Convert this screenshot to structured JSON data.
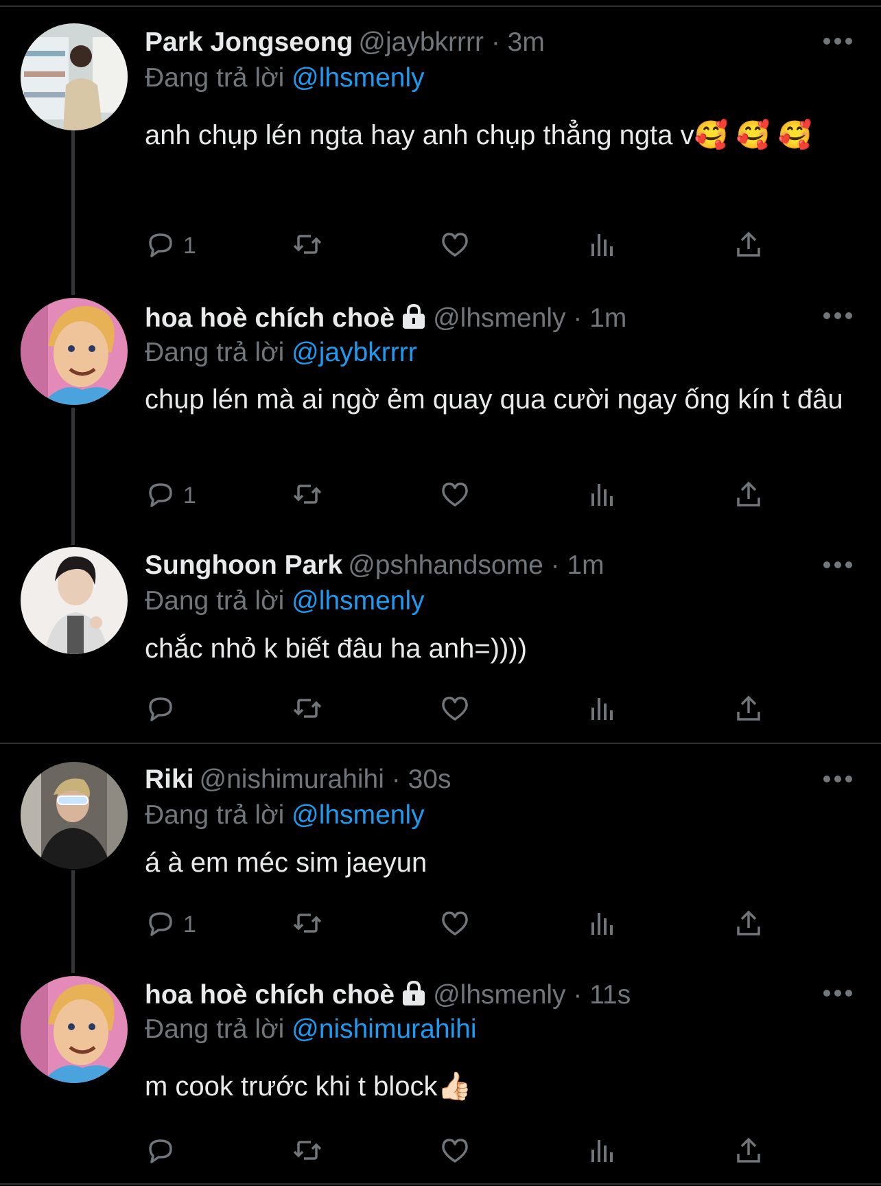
{
  "reply_prefix": "Đang trả lời",
  "icons": {
    "reply": "reply-icon",
    "retweet": "retweet-icon",
    "like": "heart-icon",
    "views": "views-icon",
    "share": "share-icon",
    "more": "more-icon",
    "lock": "lock-icon"
  },
  "colors": {
    "background": "#000000",
    "text": "#e7e9ea",
    "muted": "#71767b",
    "mention": "#1d9bf0",
    "line": "#333639"
  },
  "tweets": [
    {
      "name": "Park Jongseong",
      "handle": "@jaybkrrrr",
      "time": "· 3m",
      "reply_to": "@lhsmenly",
      "text": "anh chụp lén ngta hay anh chụp thẳng ngta v🥰 🥰 🥰",
      "reply_count": "1",
      "locked": false
    },
    {
      "name": "hoa hoè chích choè",
      "handle": "@lhsmenly",
      "time": "· 1m",
      "reply_to": "@jaybkrrrr",
      "text": "chụp lén mà ai ngờ ẻm quay qua cười ngay ống kín t đâu",
      "reply_count": "1",
      "locked": true
    },
    {
      "name": "Sunghoon Park",
      "handle": "@pshhandsome",
      "time": "· 1m",
      "reply_to": "@lhsmenly",
      "text": "chắc nhỏ k biết đâu ha anh=))))",
      "reply_count": "",
      "locked": false
    },
    {
      "name": "Riki",
      "handle": "@nishimurahihi",
      "time": "· 30s",
      "reply_to": "@lhsmenly",
      "text": "á à em méc sim jaeyun",
      "reply_count": "1",
      "locked": false
    },
    {
      "name": "hoa hoè chích choè",
      "handle": "@lhsmenly",
      "time": "· 11s",
      "reply_to": "@nishimurahihi",
      "text": "m cook trước khi t block👍🏻",
      "reply_count": "",
      "locked": true
    }
  ]
}
